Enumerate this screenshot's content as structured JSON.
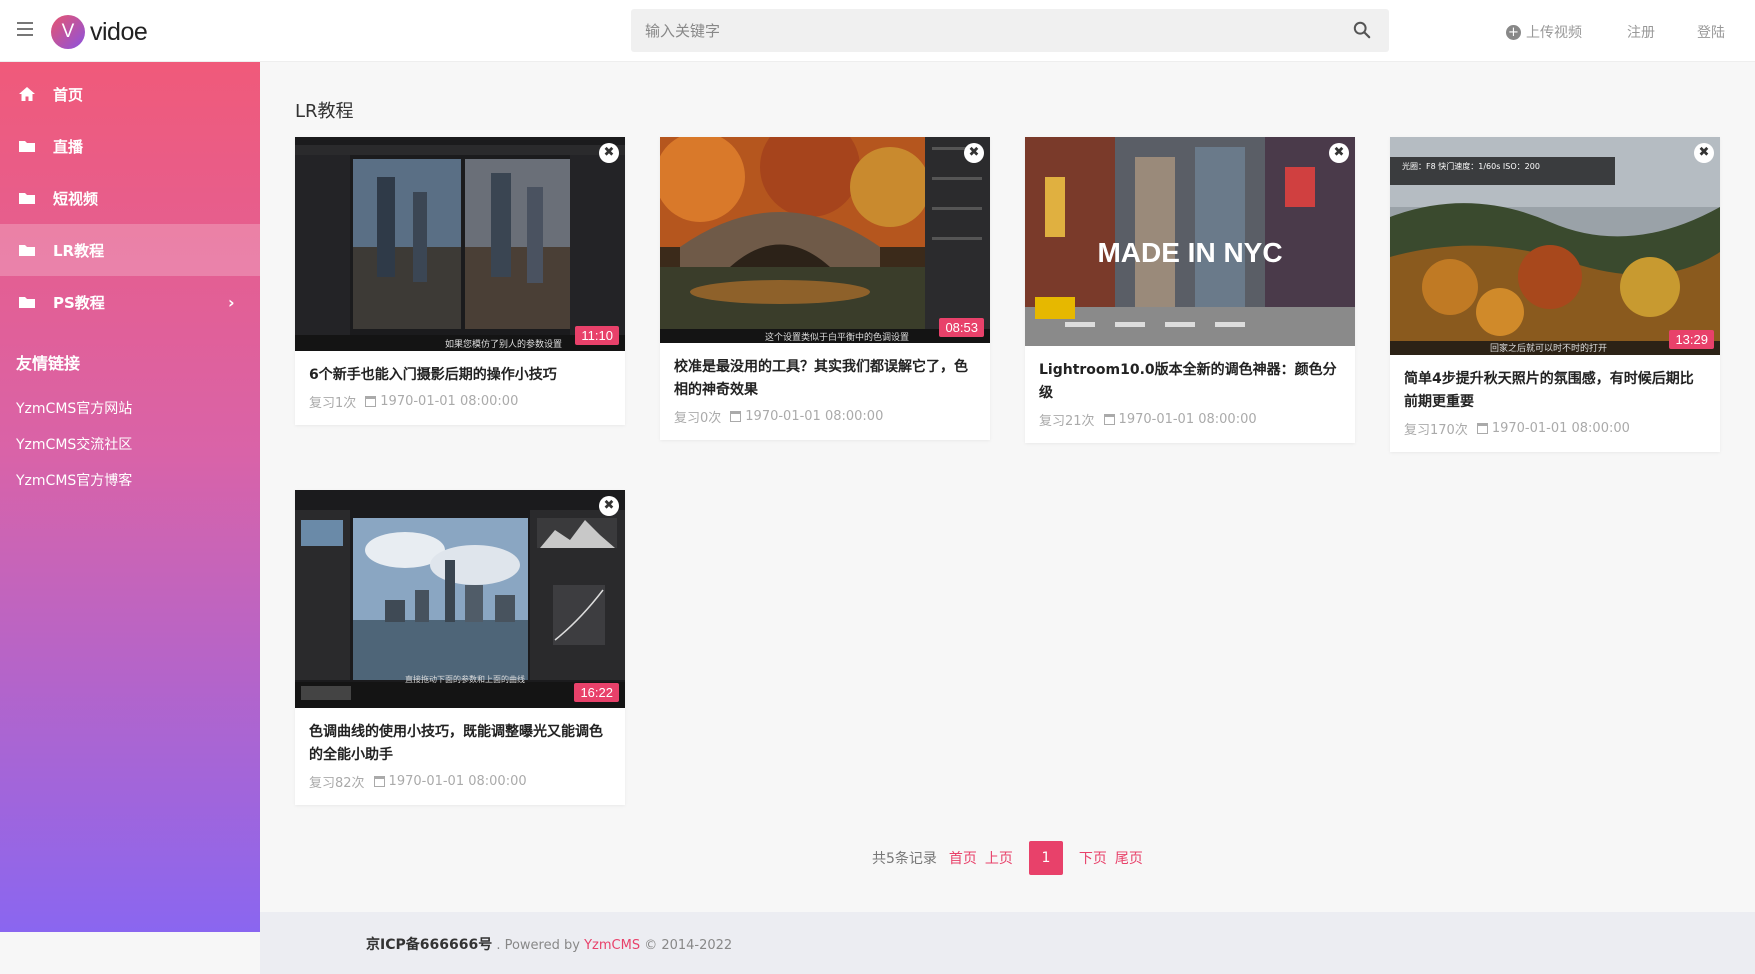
{
  "header": {
    "logo_letter": "V",
    "logo_text": "vidoe",
    "search_placeholder": "输入关键字",
    "upload_label": "上传视频",
    "register_label": "注册",
    "login_label": "登陆"
  },
  "sidebar": {
    "items": [
      {
        "label": "首页",
        "icon": "home-icon"
      },
      {
        "label": "直播",
        "icon": "folder-icon"
      },
      {
        "label": "短视频",
        "icon": "folder-icon"
      },
      {
        "label": "LR教程",
        "icon": "folder-icon",
        "active": true
      },
      {
        "label": "PS教程",
        "icon": "folder-icon",
        "has_submenu": true
      }
    ],
    "links_title": "友情链接",
    "links": [
      "YzmCMS官方网站",
      "YzmCMS交流社区",
      "YzmCMS官方博客"
    ]
  },
  "main": {
    "section_title": "LR教程",
    "videos": [
      {
        "title": "6个新手也能入门摄影后期的操作小技巧",
        "views": "复习1次",
        "date": "1970-01-01 08:00:00",
        "duration": "11:10",
        "caption": "如果您模仿了别人的参数设置"
      },
      {
        "title": "校准是最没用的工具？其实我们都误解它了，色相的神奇效果",
        "views": "复习0次",
        "date": "1970-01-01 08:00:00",
        "duration": "08:53",
        "caption": "这个设置类似于白平衡中的色调设置"
      },
      {
        "title": "Lightroom10.0版本全新的调色神器：颜色分级",
        "views": "复习21次",
        "date": "1970-01-01 08:00:00",
        "duration": "",
        "caption": "MADE IN NYC"
      },
      {
        "title": "简单4步提升秋天照片的氛围感，有时候后期比前期更重要",
        "views": "复习170次",
        "date": "1970-01-01 08:00:00",
        "duration": "13:29",
        "caption": "回家之后就可以时不时的打开"
      },
      {
        "title": "色调曲线的使用小技巧，既能调整曝光又能调色的全能小助手",
        "views": "复习82次",
        "date": "1970-01-01 08:00:00",
        "duration": "16:22",
        "caption": "直接拖动下面的参数和上面的曲线"
      }
    ],
    "exif_caption": "光圈：F8  快门速度：1/60s  ISO：200"
  },
  "pagination": {
    "total": "共5条记录",
    "first": "首页",
    "prev": "上页",
    "current": "1",
    "next": "下页",
    "last": "尾页"
  },
  "footer": {
    "icp": "京ICP备666666号",
    "powered_prefix": " . Powered by ",
    "brand": "YzmCMS",
    "copyright": " © 2014-2022"
  },
  "colors": {
    "accent": "#e8416a",
    "sidebar_top": "#f05a7a",
    "sidebar_bottom": "#8a66f0"
  }
}
